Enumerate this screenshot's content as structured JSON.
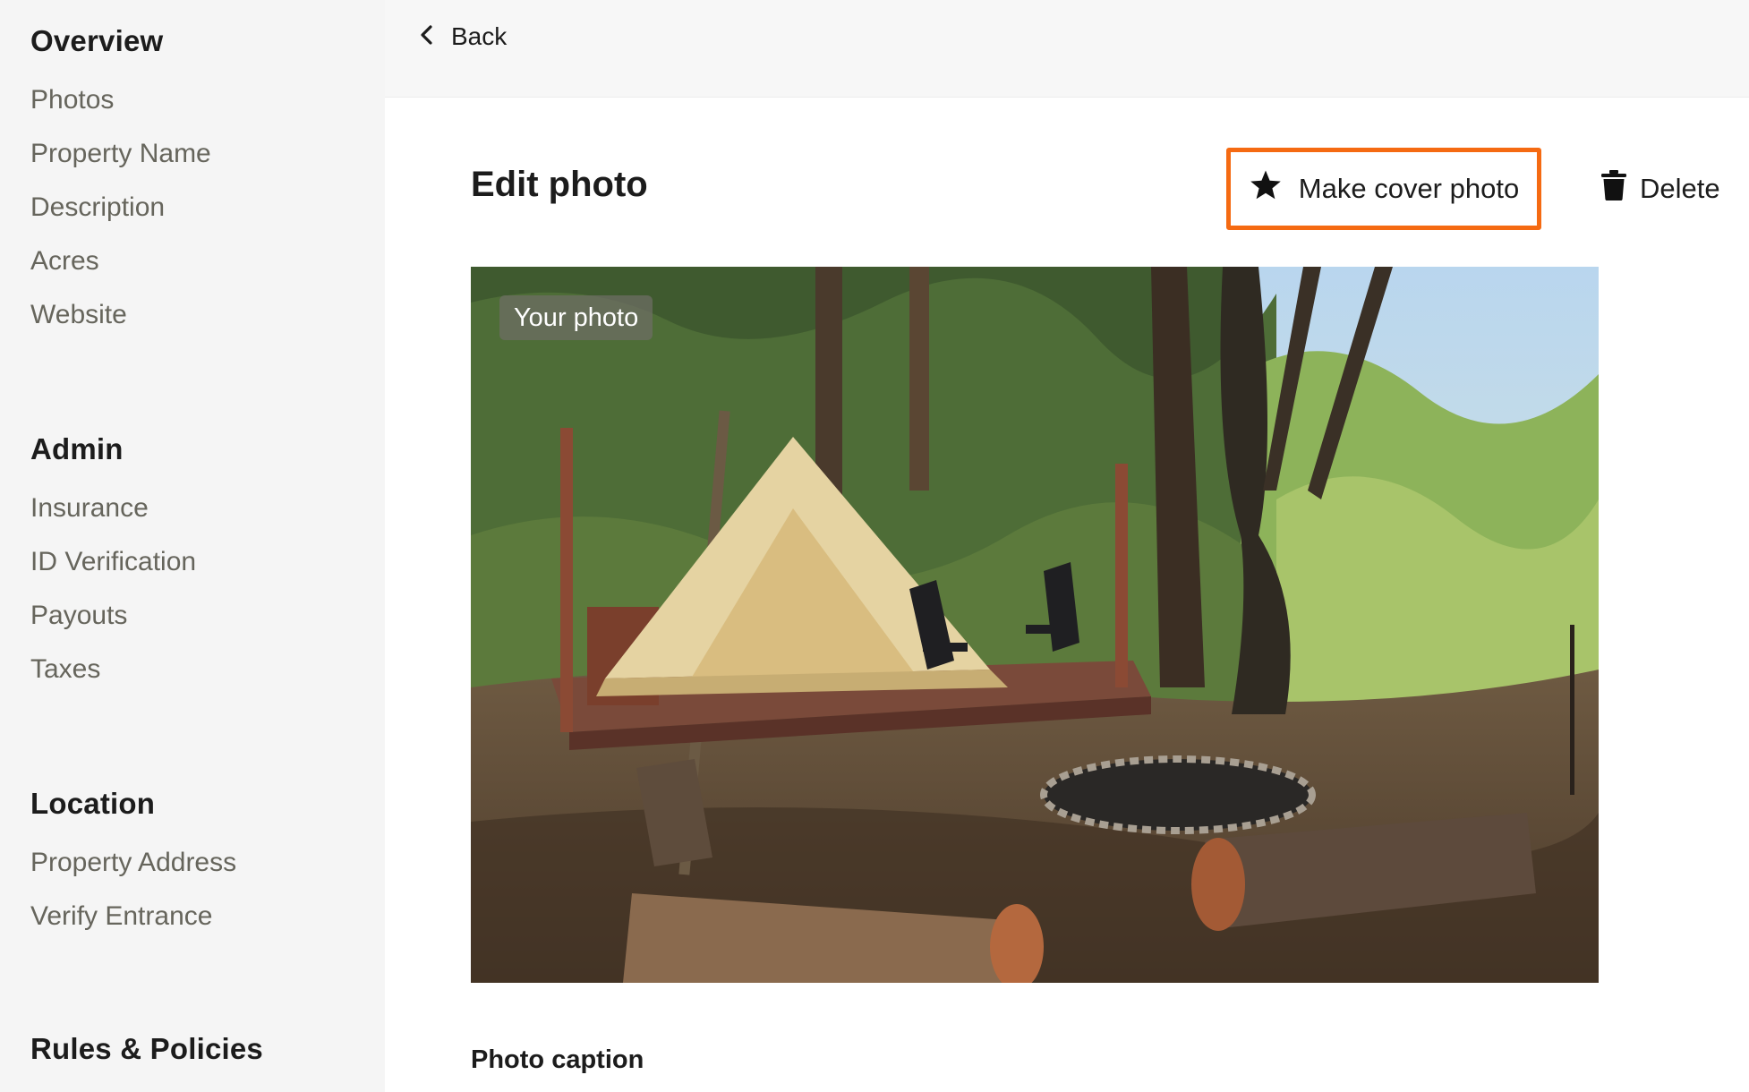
{
  "sidebar": {
    "sections": [
      {
        "heading": "Overview",
        "items": [
          "Photos",
          "Property Name",
          "Description",
          "Acres",
          "Website"
        ]
      },
      {
        "heading": "Admin",
        "items": [
          "Insurance",
          "ID Verification",
          "Payouts",
          "Taxes"
        ]
      },
      {
        "heading": "Location",
        "items": [
          "Property Address",
          "Verify Entrance"
        ]
      },
      {
        "heading": "Rules & Policies",
        "items": []
      }
    ]
  },
  "topbar": {
    "back_label": "Back",
    "back_icon": "chevron-left-icon"
  },
  "main": {
    "title": "Edit photo",
    "cover_button_label": "Make cover photo",
    "cover_button_icon": "star-icon",
    "delete_button_label": "Delete",
    "delete_button_icon": "trash-icon",
    "photo_badge": "Your photo",
    "caption_label": "Photo caption"
  },
  "colors": {
    "highlight_border": "#f56a12",
    "sidebar_bg": "#f5f5f5",
    "sidebar_item_text": "#66655c"
  }
}
